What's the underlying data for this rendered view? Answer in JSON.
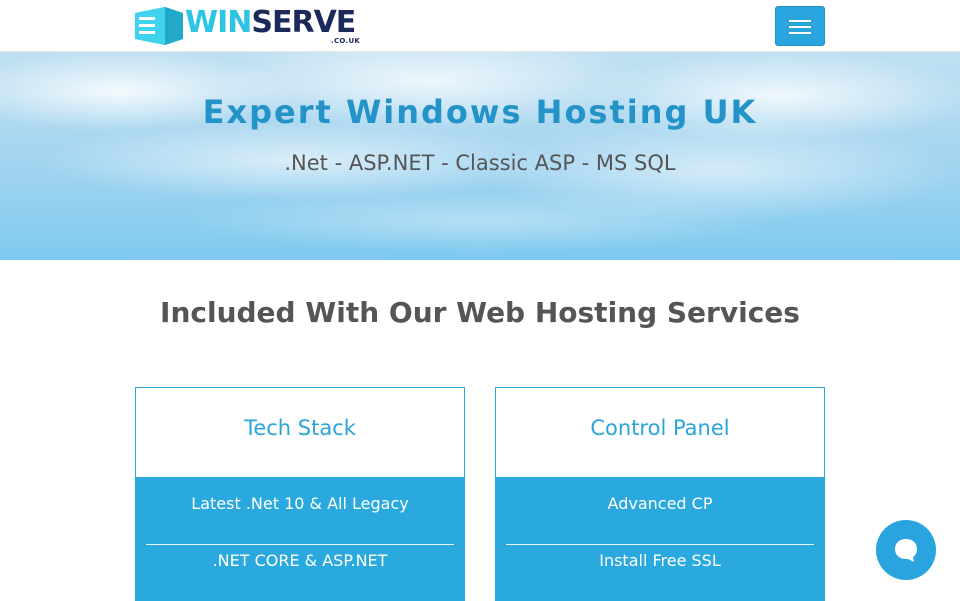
{
  "header": {
    "logo": {
      "word_1": "WIN",
      "word_2": "SERVE",
      "suffix": ".CO.UK"
    },
    "menu_icon": "hamburger-menu-icon"
  },
  "hero": {
    "title": "Expert Windows Hosting UK",
    "subtitle": ".Net - ASP.NET - Classic ASP - MS SQL"
  },
  "services": {
    "heading": "Included With Our Web Hosting Services",
    "cards": [
      {
        "title": "Tech Stack",
        "features": [
          "Latest .Net 10 & All Legacy",
          ".NET CORE & ASP.NET"
        ]
      },
      {
        "title": "Control Panel",
        "features": [
          "Advanced CP",
          "Install Free SSL"
        ]
      }
    ]
  },
  "chat": {
    "icon": "chat-bubble-icon"
  },
  "colors": {
    "brand_cyan": "#2ec4e3",
    "brand_navy": "#1b2a5a",
    "accent_blue": "#2aa4de",
    "hero_title": "#2493c7"
  }
}
